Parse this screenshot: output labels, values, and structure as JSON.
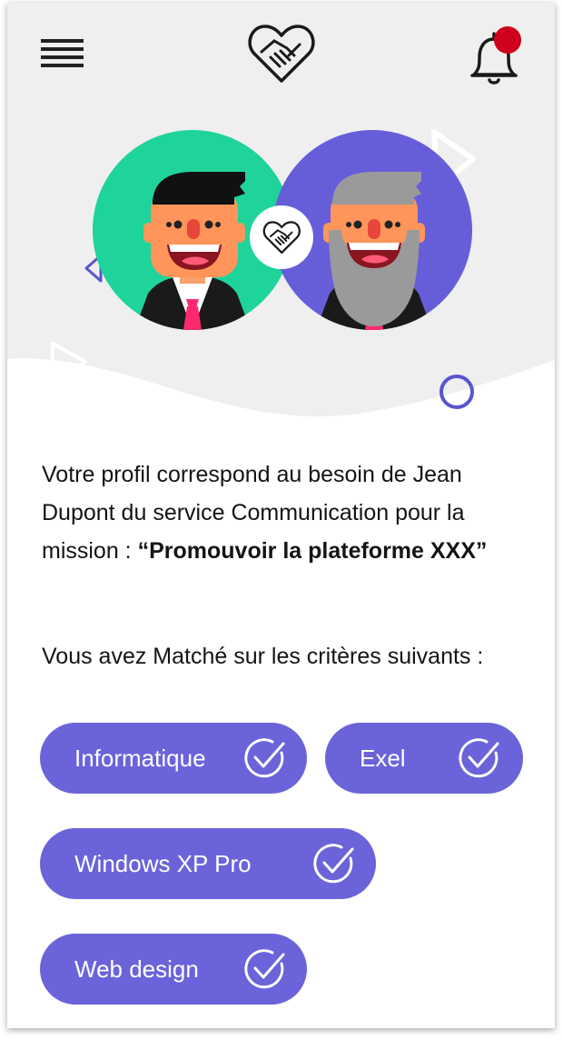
{
  "header": {
    "menu_icon": "hamburger-menu-icon",
    "logo_icon": "handshake-heart-icon",
    "notification_icon": "bell-icon",
    "notification_badge_color": "#d0021b"
  },
  "illustration": {
    "left_avatar_bg": "#1fd49a",
    "right_avatar_bg": "#665ed9",
    "center_icon": "handshake-heart-icon"
  },
  "message": {
    "intro": "Votre profil correspond au besoin de Jean Dupont du service Communication pour la mission : ",
    "mission": "“Promouvoir la plateforme XXX”"
  },
  "criteria": {
    "title": "Vous avez Matché sur les critères suivants :",
    "items": [
      {
        "label": "Informatique",
        "icon": "check-circle-icon"
      },
      {
        "label": "Exel",
        "icon": "check-circle-icon"
      },
      {
        "label": "Windows XP Pro",
        "icon": "check-circle-icon"
      },
      {
        "label": "Web design",
        "icon": "check-circle-icon"
      }
    ]
  },
  "colors": {
    "accent": "#6b63d9",
    "hero_background": "#efefef"
  }
}
